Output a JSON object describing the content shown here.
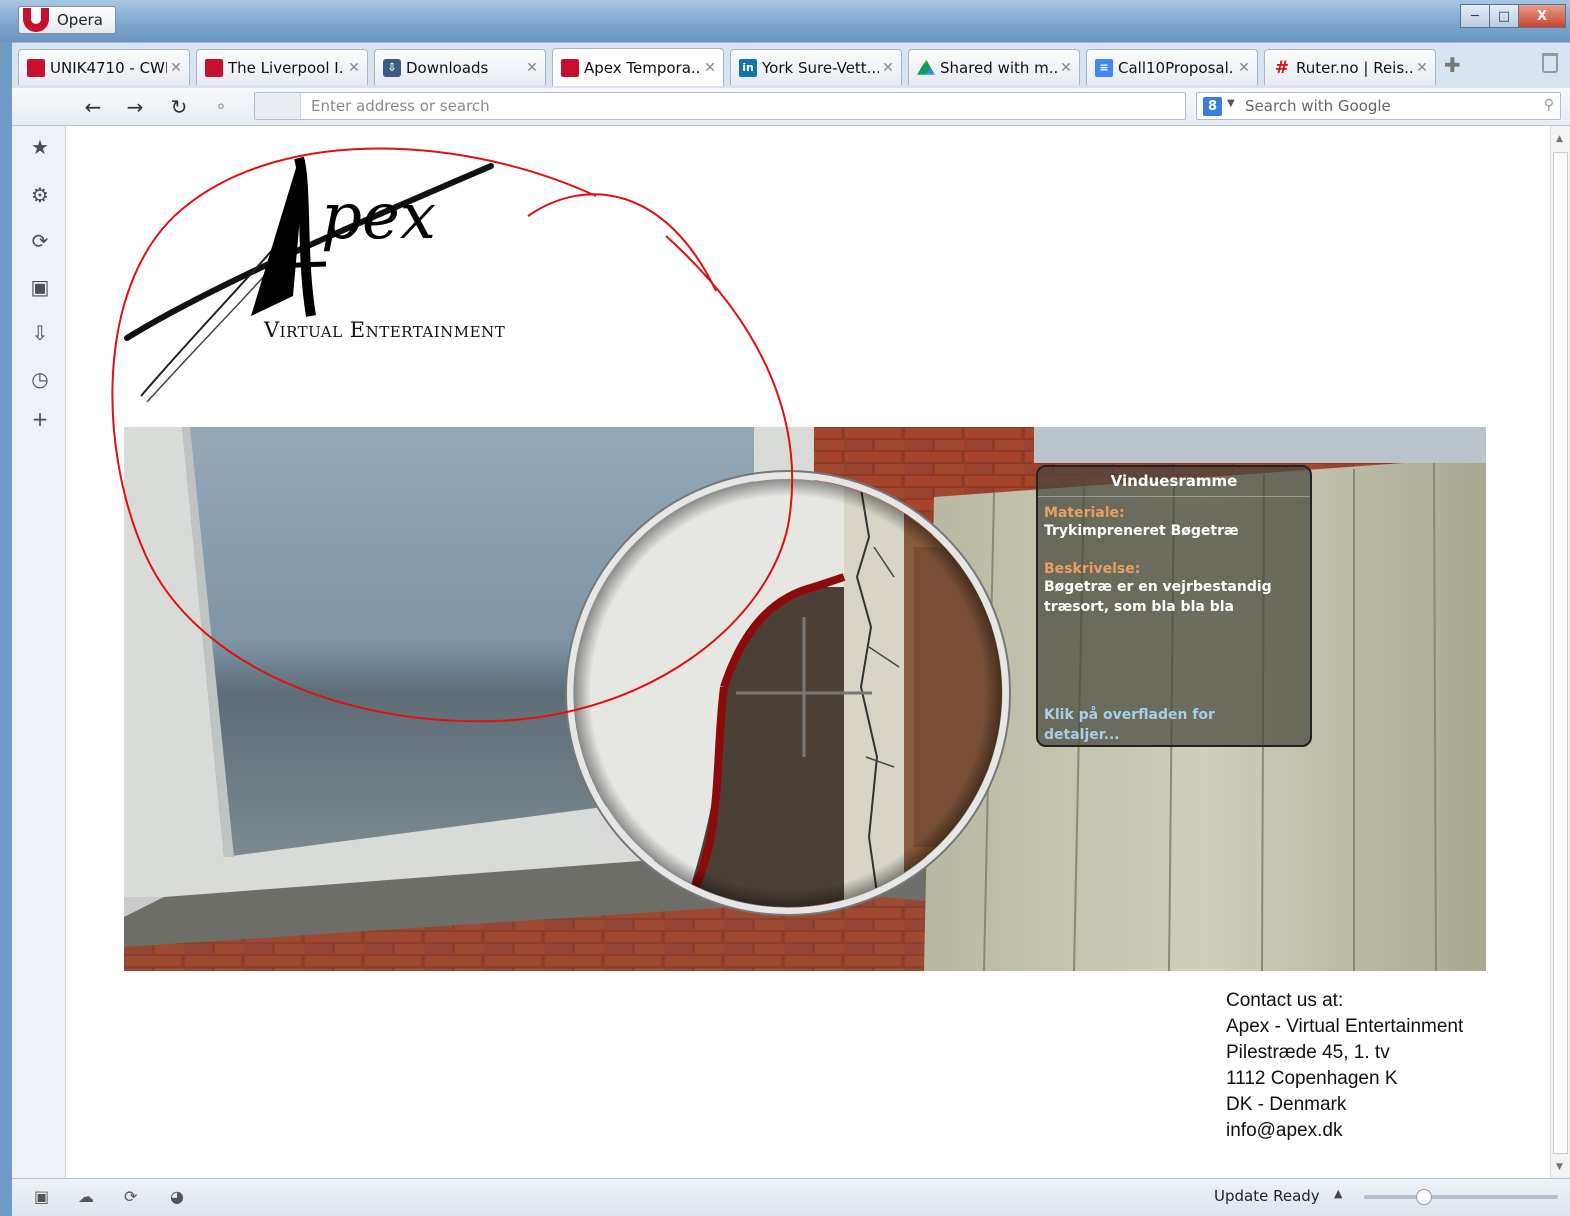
{
  "window": {
    "app_button_label": "Opera",
    "controls": [
      "minimize",
      "maximize",
      "close"
    ],
    "close_label": "X"
  },
  "tabs": [
    {
      "label": "UNIK4710 - CWI",
      "icon": "opera-icon",
      "active": false
    },
    {
      "label": "The Liverpool I...",
      "icon": "opera-icon",
      "active": false
    },
    {
      "label": "Downloads",
      "icon": "downloads-icon",
      "active": false
    },
    {
      "label": "Apex Tempora...",
      "icon": "opera-icon",
      "active": true
    },
    {
      "label": "York Sure-Vett...",
      "icon": "linkedin-icon",
      "active": false
    },
    {
      "label": "Shared with m...",
      "icon": "google-drive-icon",
      "active": false
    },
    {
      "label": "Call10Proposal...",
      "icon": "google-docs-icon",
      "active": false
    },
    {
      "label": "Ruter.no | Reis...",
      "icon": "hash-icon",
      "active": false
    }
  ],
  "navbar": {
    "address_value": "",
    "address_placeholder": "Enter address or search",
    "search_placeholder": "Search with Google",
    "search_engine_label": "8"
  },
  "sidepanel": [
    "bookmarks-icon",
    "extensions-icon",
    "unite-icon",
    "notes-icon",
    "downloads-icon",
    "history-icon",
    "add-panel-icon"
  ],
  "logo": {
    "name": "Apex",
    "subtitle": "Virtual Entertainment"
  },
  "info_panel": {
    "title": "Vinduesramme",
    "material_label": "Materiale:",
    "material_value": "Trykimpreneret Bøgetræ",
    "description_label": "Beskrivelse:",
    "description_value_line1": "Bøgetræ er en vejrbestandig",
    "description_value_line2": "træsort, som bla bla bla",
    "hint_line1": "Klik på overfladen for",
    "hint_line2": "detaljer..."
  },
  "contact": {
    "heading": "Contact us at:",
    "company": "Apex - Virtual Entertainment",
    "street": "Pilestræde 45, 1. tv",
    "city": "1112 Copenhagen K",
    "country": "DK - Denmark",
    "email": "info@apex.dk"
  },
  "statusbar": {
    "update_label": "Update Ready"
  },
  "colors": {
    "annotation_red": "#e01010",
    "label_orange": "#e8a060",
    "hint_blue": "#a7cfe6",
    "opera_red": "#c8102e"
  }
}
